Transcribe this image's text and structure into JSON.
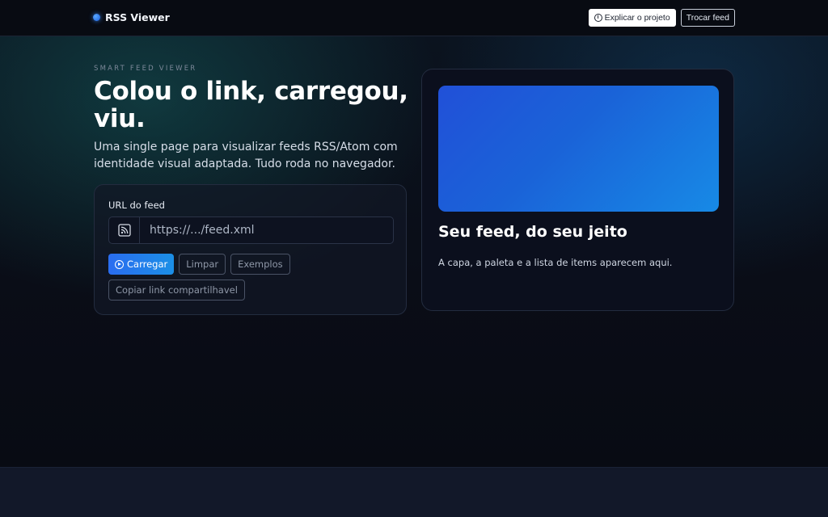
{
  "header": {
    "brand": "RSS Viewer",
    "explain_button": "Explicar o projeto",
    "switch_feed_button": "Trocar feed"
  },
  "hero": {
    "eyebrow": "SMART FEED VIEWER",
    "title": "Colou o link, carregou, viu.",
    "subtitle": "Uma single page para visualizar feeds RSS/Atom com identidade visual adaptada. Tudo roda no navegador."
  },
  "form": {
    "label": "URL do feed",
    "url_placeholder": "https://.../feed.xml",
    "url_value": "",
    "load_button": "Carregar",
    "clear_button": "Limpar",
    "examples_button": "Exemplos",
    "copy_link_button": "Copiar link compartilhavel"
  },
  "preview": {
    "title": "Seu feed, do seu jeito",
    "subtitle": "A capa, a paleta e a lista de items aparecem aqui."
  },
  "colors": {
    "accent": "#2a6df0",
    "accent_light": "#1b8fe6",
    "background": "#0a0d17"
  },
  "icons": {
    "brand": "dot-icon",
    "explain": "info-icon",
    "url": "rss-icon",
    "load": "play-circle-icon"
  }
}
